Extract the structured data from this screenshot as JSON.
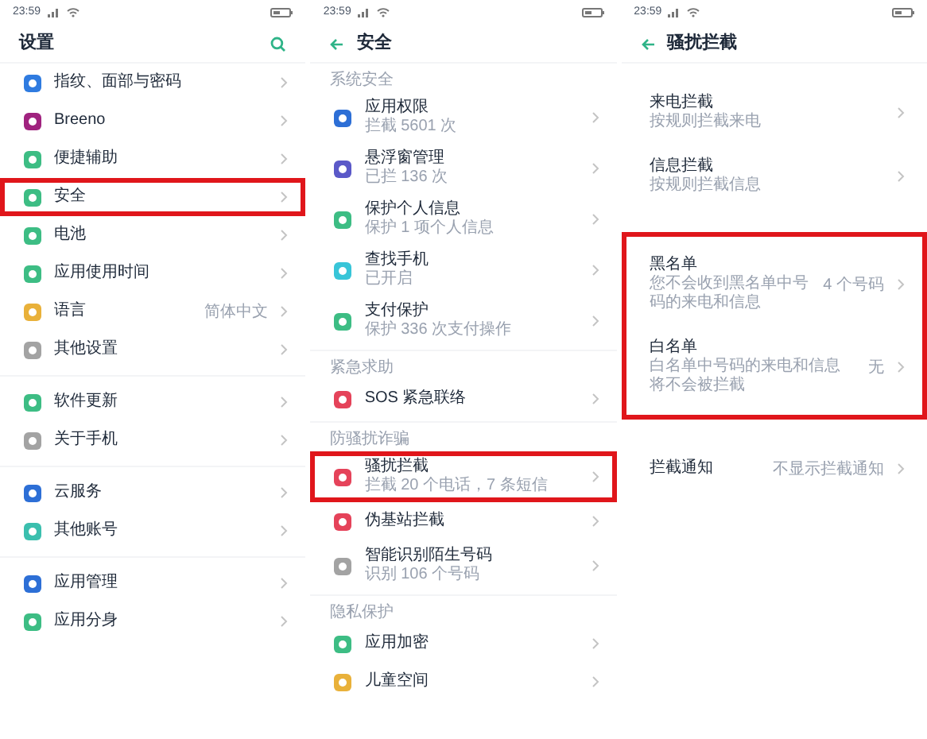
{
  "screens": [
    {
      "status_time": "23:59",
      "header": {
        "title": "设置",
        "kind": "search"
      },
      "groups": [
        {
          "items": [
            {
              "label": "指纹、面部与密码",
              "color": "#2f7be0",
              "highlighted": false
            },
            {
              "label": "Breeno",
              "color": "#a0237f",
              "highlighted": false
            },
            {
              "label": "便捷辅助",
              "color": "#3dbd84",
              "highlighted": false
            },
            {
              "label": "安全",
              "color": "#3dbd84",
              "highlighted": true
            },
            {
              "label": "电池",
              "color": "#3dbd84",
              "highlighted": false
            },
            {
              "label": "应用使用时间",
              "color": "#3dbd84",
              "highlighted": false
            },
            {
              "label": "语言",
              "value": "简体中文",
              "color": "#e9b13a",
              "highlighted": false
            },
            {
              "label": "其他设置",
              "color": "#a3a3a3",
              "highlighted": false
            }
          ]
        },
        {
          "items": [
            {
              "label": "软件更新",
              "color": "#3dbd84",
              "highlighted": false
            },
            {
              "label": "关于手机",
              "color": "#a3a3a3",
              "highlighted": false
            }
          ]
        },
        {
          "items": [
            {
              "label": "云服务",
              "color": "#2d6fd6",
              "highlighted": false
            },
            {
              "label": "其他账号",
              "color": "#3bbfae",
              "highlighted": false
            }
          ]
        },
        {
          "items": [
            {
              "label": "应用管理",
              "color": "#2d6fd6",
              "highlighted": false
            },
            {
              "label": "应用分身",
              "color": "#3dbd84",
              "highlighted": false
            }
          ]
        }
      ]
    },
    {
      "status_time": "23:59",
      "header": {
        "title": "安全",
        "kind": "back"
      },
      "groups": [
        {
          "label": "系统安全",
          "items": [
            {
              "label": "应用权限",
              "subtitle": "拦截 5601 次",
              "color": "#2d6fd6",
              "highlighted": false
            },
            {
              "label": "悬浮窗管理",
              "subtitle": "已拦 136 次",
              "color": "#5b59c8",
              "highlighted": false
            },
            {
              "label": "保护个人信息",
              "subtitle": "保护 1 项个人信息",
              "color": "#3dbd84",
              "highlighted": false
            },
            {
              "label": "查找手机",
              "subtitle": "已开启",
              "color": "#38c5d8",
              "highlighted": false
            },
            {
              "label": "支付保护",
              "subtitle": "保护 336 次支付操作",
              "color": "#3dbd84",
              "highlighted": false
            }
          ]
        },
        {
          "label": "紧急求助",
          "items": [
            {
              "label": "SOS 紧急联络",
              "color": "#e5435a",
              "highlighted": false
            }
          ]
        },
        {
          "label": "防骚扰诈骗",
          "items": [
            {
              "label": "骚扰拦截",
              "subtitle": "拦截 20 个电话，7 条短信",
              "color": "#e5435a",
              "highlighted": true
            },
            {
              "label": "伪基站拦截",
              "color": "#e5435a",
              "highlighted": false
            },
            {
              "label": "智能识别陌生号码",
              "subtitle": "识别 106 个号码",
              "color": "#a3a3a3",
              "highlighted": false
            }
          ]
        },
        {
          "label": "隐私保护",
          "items": [
            {
              "label": "应用加密",
              "color": "#3dbd84",
              "highlighted": false
            },
            {
              "label": "儿童空间",
              "color": "#e9b13a",
              "highlighted": false
            }
          ]
        }
      ]
    },
    {
      "status_time": "23:59",
      "header": {
        "title": "骚扰拦截",
        "kind": "back"
      },
      "groups": [
        {
          "highlighted": false,
          "items": [
            {
              "label": "来电拦截",
              "subtitle": "按规则拦截来电"
            },
            {
              "label": "信息拦截",
              "subtitle": "按规则拦截信息"
            }
          ]
        },
        {
          "highlighted": true,
          "items": [
            {
              "label": "黑名单",
              "subtitle": "您不会收到黑名单中号码的来电和信息",
              "value": "4 个号码"
            },
            {
              "label": "白名单",
              "subtitle": "白名单中号码的来电和信息将不会被拦截",
              "value": "无"
            }
          ]
        },
        {
          "highlighted": false,
          "items": [
            {
              "label": "拦截通知",
              "value": "不显示拦截通知"
            }
          ]
        }
      ]
    }
  ]
}
